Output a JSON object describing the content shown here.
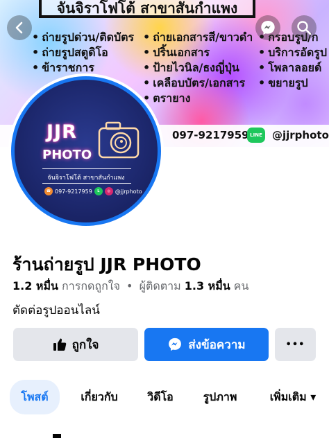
{
  "cover": {
    "title": "จันจิราโฟโต้ สาขาสันกำแพง",
    "services_col1": [
      "ถ่ายรูปด่วน/ติดบัตร",
      "ถ่ายรูปสตูดิโอ",
      "ข้าราชการ"
    ],
    "services_col2": [
      "ถ่ายเอกสารสี/ขาวดำ",
      "ปริ้นเอกสาร",
      "ป้ายไวนิล/ธงญี่ปุ่น",
      "เคลือบบัตร/เอกสาร",
      "ตรายาง"
    ],
    "services_col3": [
      "กรอบรูป/ก",
      "บริการอัดรูป",
      "โพลาลอยด์",
      "ขยายรูป"
    ],
    "phone": "097-9217959",
    "line_badge": "LINE",
    "instagram": "@jjrphoto"
  },
  "avatar": {
    "logo_text": "JJR",
    "logo_sub": "PHOTO",
    "branch": "จันจิราโฟโต้ สาขาสันกำแพง",
    "phone": "097-9217959",
    "instagram": "@jjrphoto"
  },
  "profile": {
    "name": "ร้านถ่ายรูป JJR PHOTO",
    "likes_count": "1.2 หมื่น",
    "likes_label": "การกดถูกใจ",
    "dot": "•",
    "followers_label": "ผู้ติดตาม",
    "followers_count": "1.3 หมื่น",
    "followers_unit": "คน",
    "category": "ตัดต่อรูปออนไลน์"
  },
  "actions": {
    "like_label": "ถูกใจ",
    "message_label": "ส่งข้อความ",
    "more_label": "•••"
  },
  "tabs": [
    {
      "label": "โพสต์",
      "active": true
    },
    {
      "label": "เกี่ยวกับ",
      "active": false
    },
    {
      "label": "วิดีโอ",
      "active": false
    },
    {
      "label": "รูปภาพ",
      "active": false
    },
    {
      "label": "เพิ่มเติม ▾",
      "active": false
    }
  ],
  "colors": {
    "facebook_blue": "#1877f2",
    "button_gray": "#e4e6eb",
    "active_tab_bg": "#e7f0fd",
    "logo_navy": "#1a2466",
    "line_green": "#1ec75c"
  }
}
